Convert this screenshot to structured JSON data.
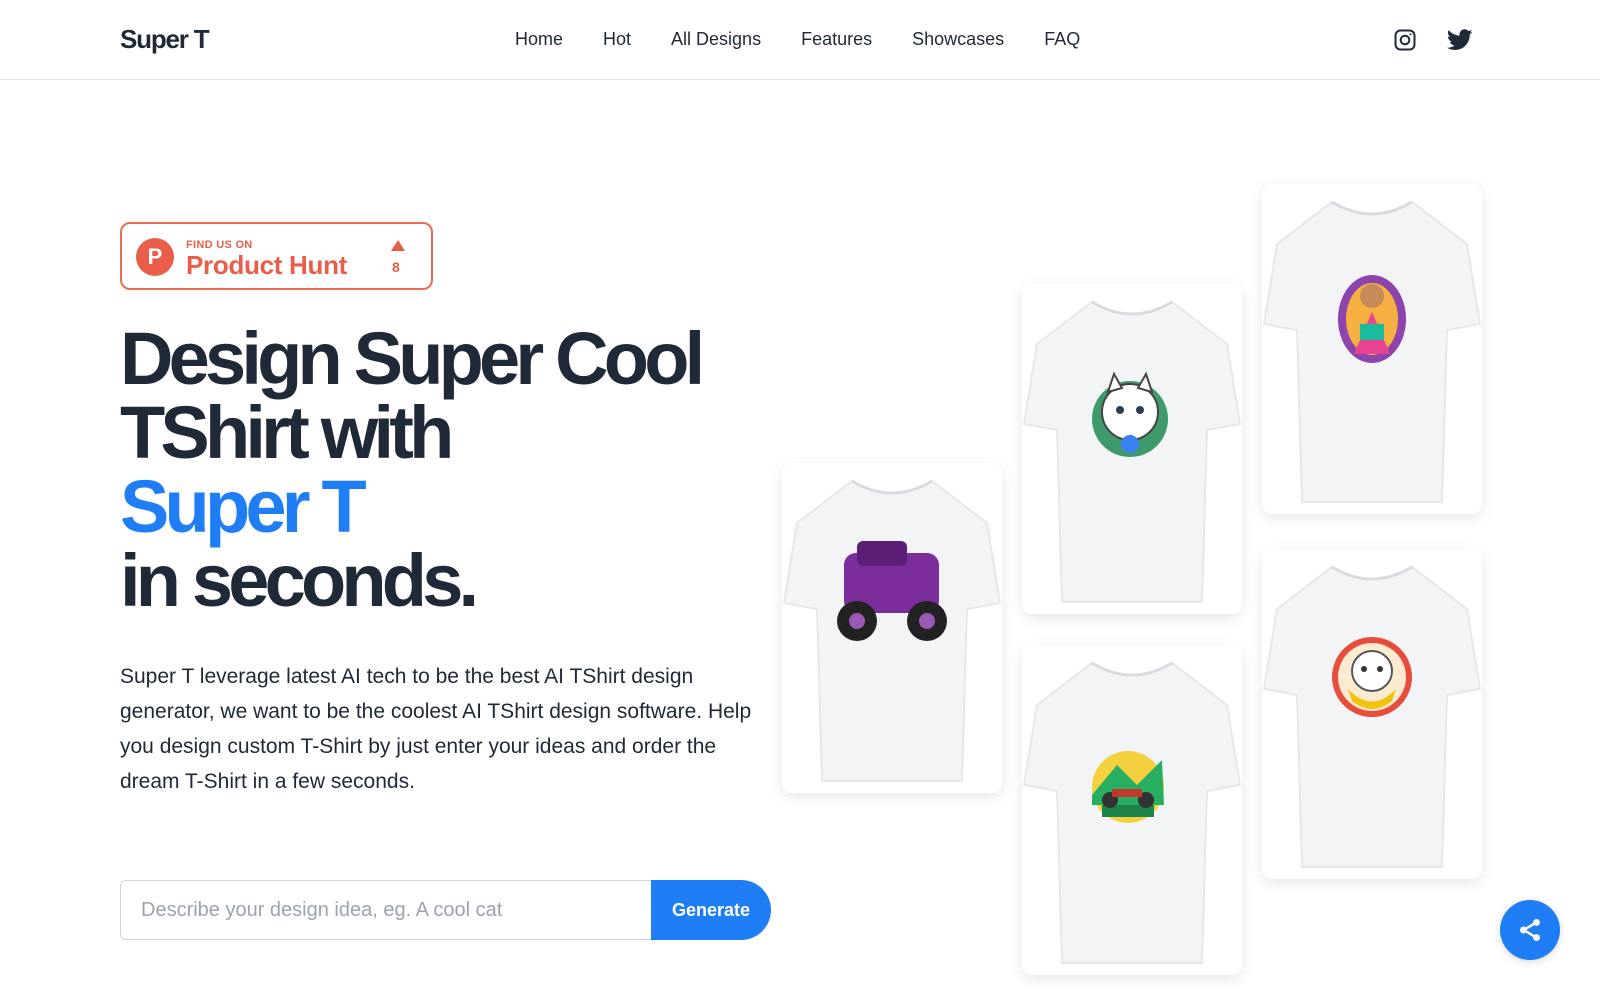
{
  "header": {
    "logo": "Super T",
    "nav": [
      "Home",
      "Hot",
      "All Designs",
      "Features",
      "Showcases",
      "FAQ"
    ],
    "social": [
      "instagram-icon",
      "twitter-icon"
    ]
  },
  "badge": {
    "find_text": "FIND US ON",
    "name": "Product Hunt",
    "logo_letter": "P",
    "count": "8"
  },
  "hero": {
    "title_line1": "Design Super Cool",
    "title_line2": "TShirt with",
    "title_accent": "Super T",
    "title_line4": "in seconds.",
    "description": "Super T leverage latest AI tech to be the best AI TShirt design generator, we want to be the coolest AI TShirt design software. Help you design custom T-Shirt by just enter your ideas and order the dream T-Shirt in a few seconds."
  },
  "generator": {
    "placeholder": "Describe your design idea, eg. A cool cat",
    "button_label": "Generate"
  },
  "showcase": {
    "shirts": [
      {
        "design": "purple monster truck"
      },
      {
        "design": "white cat with flowers"
      },
      {
        "design": "motorcycle landscape"
      },
      {
        "design": "girl in colorful dress"
      },
      {
        "design": "cat in a teacup"
      }
    ]
  },
  "colors": {
    "accent": "#1f7ef6",
    "text": "#1f2937",
    "product_hunt": "#ea5e49"
  },
  "share": {
    "icon": "share-icon"
  }
}
